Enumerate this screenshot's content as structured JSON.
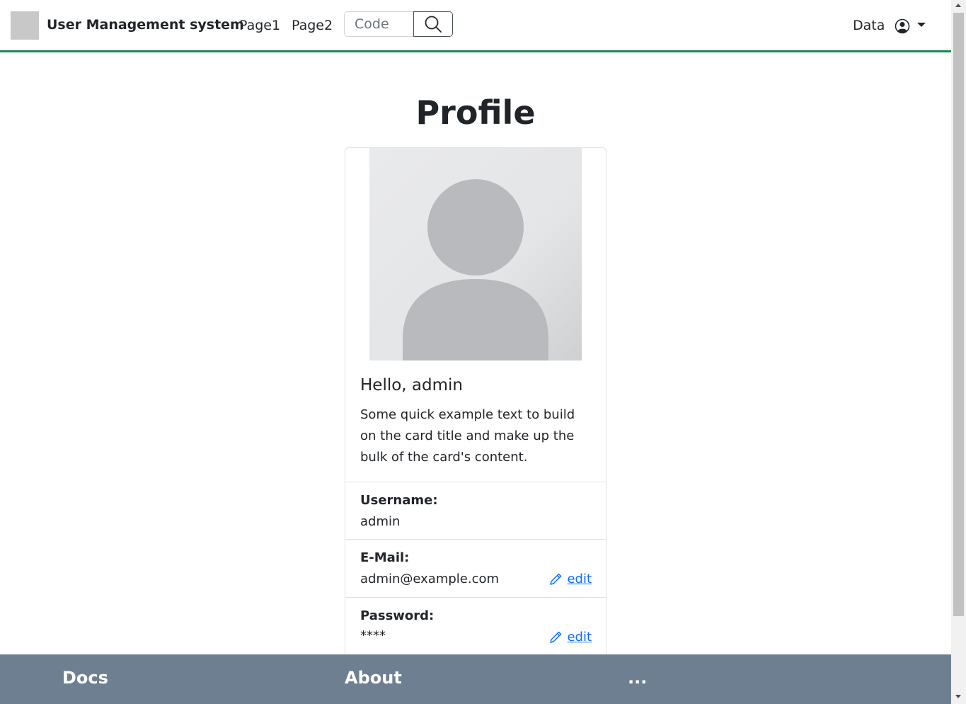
{
  "navbar": {
    "brand": "User Management system",
    "links": [
      "Page1",
      "Page2"
    ],
    "search_placeholder": "Code",
    "right_link": "Data",
    "search_icon": "search-icon",
    "user_icon": "user-circle-icon",
    "accent_color": "#198754"
  },
  "main": {
    "title": "Profile",
    "card": {
      "avatar_icon": "default-avatar-image",
      "greeting": "Hello, admin",
      "text": "Some quick example text to build on the card title and make up the bulk of the card's content.",
      "fields": [
        {
          "label": "Username:",
          "value": "admin"
        },
        {
          "label": "E-Mail:",
          "value": "admin@example.com",
          "action": "edit"
        },
        {
          "label": "Password:",
          "value": "****",
          "action": "edit"
        }
      ]
    }
  },
  "footer": {
    "items": [
      "Docs",
      "About",
      "..."
    ],
    "background": "#6e7f91"
  }
}
